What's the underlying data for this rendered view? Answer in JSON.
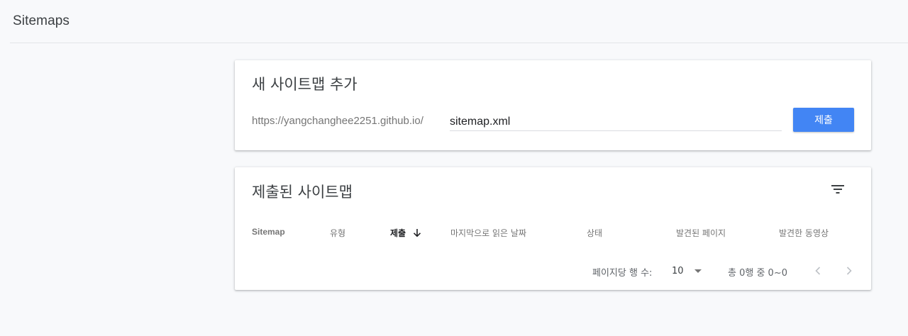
{
  "header": {
    "title": "Sitemaps"
  },
  "add_card": {
    "title": "새 사이트맵 추가",
    "url_prefix": "https://yangchanghee2251.github.io/",
    "input_value": "sitemap.xml",
    "submit_label": "제출",
    "submit_color": "#4285f4"
  },
  "list_card": {
    "title": "제출된 사이트맵",
    "filter_icon": "filter-icon",
    "columns": [
      "Sitemap",
      "유형",
      "제출",
      "마지막으로 읽은 날짜",
      "상태",
      "발견된 페이지",
      "발견한 동영상"
    ],
    "sorted_column_icon": "arrow-down-icon",
    "rows_per_page_label": "페이지당 행 수:",
    "rows_per_page_value": "10",
    "summary": "총 0행 중 0~0"
  }
}
